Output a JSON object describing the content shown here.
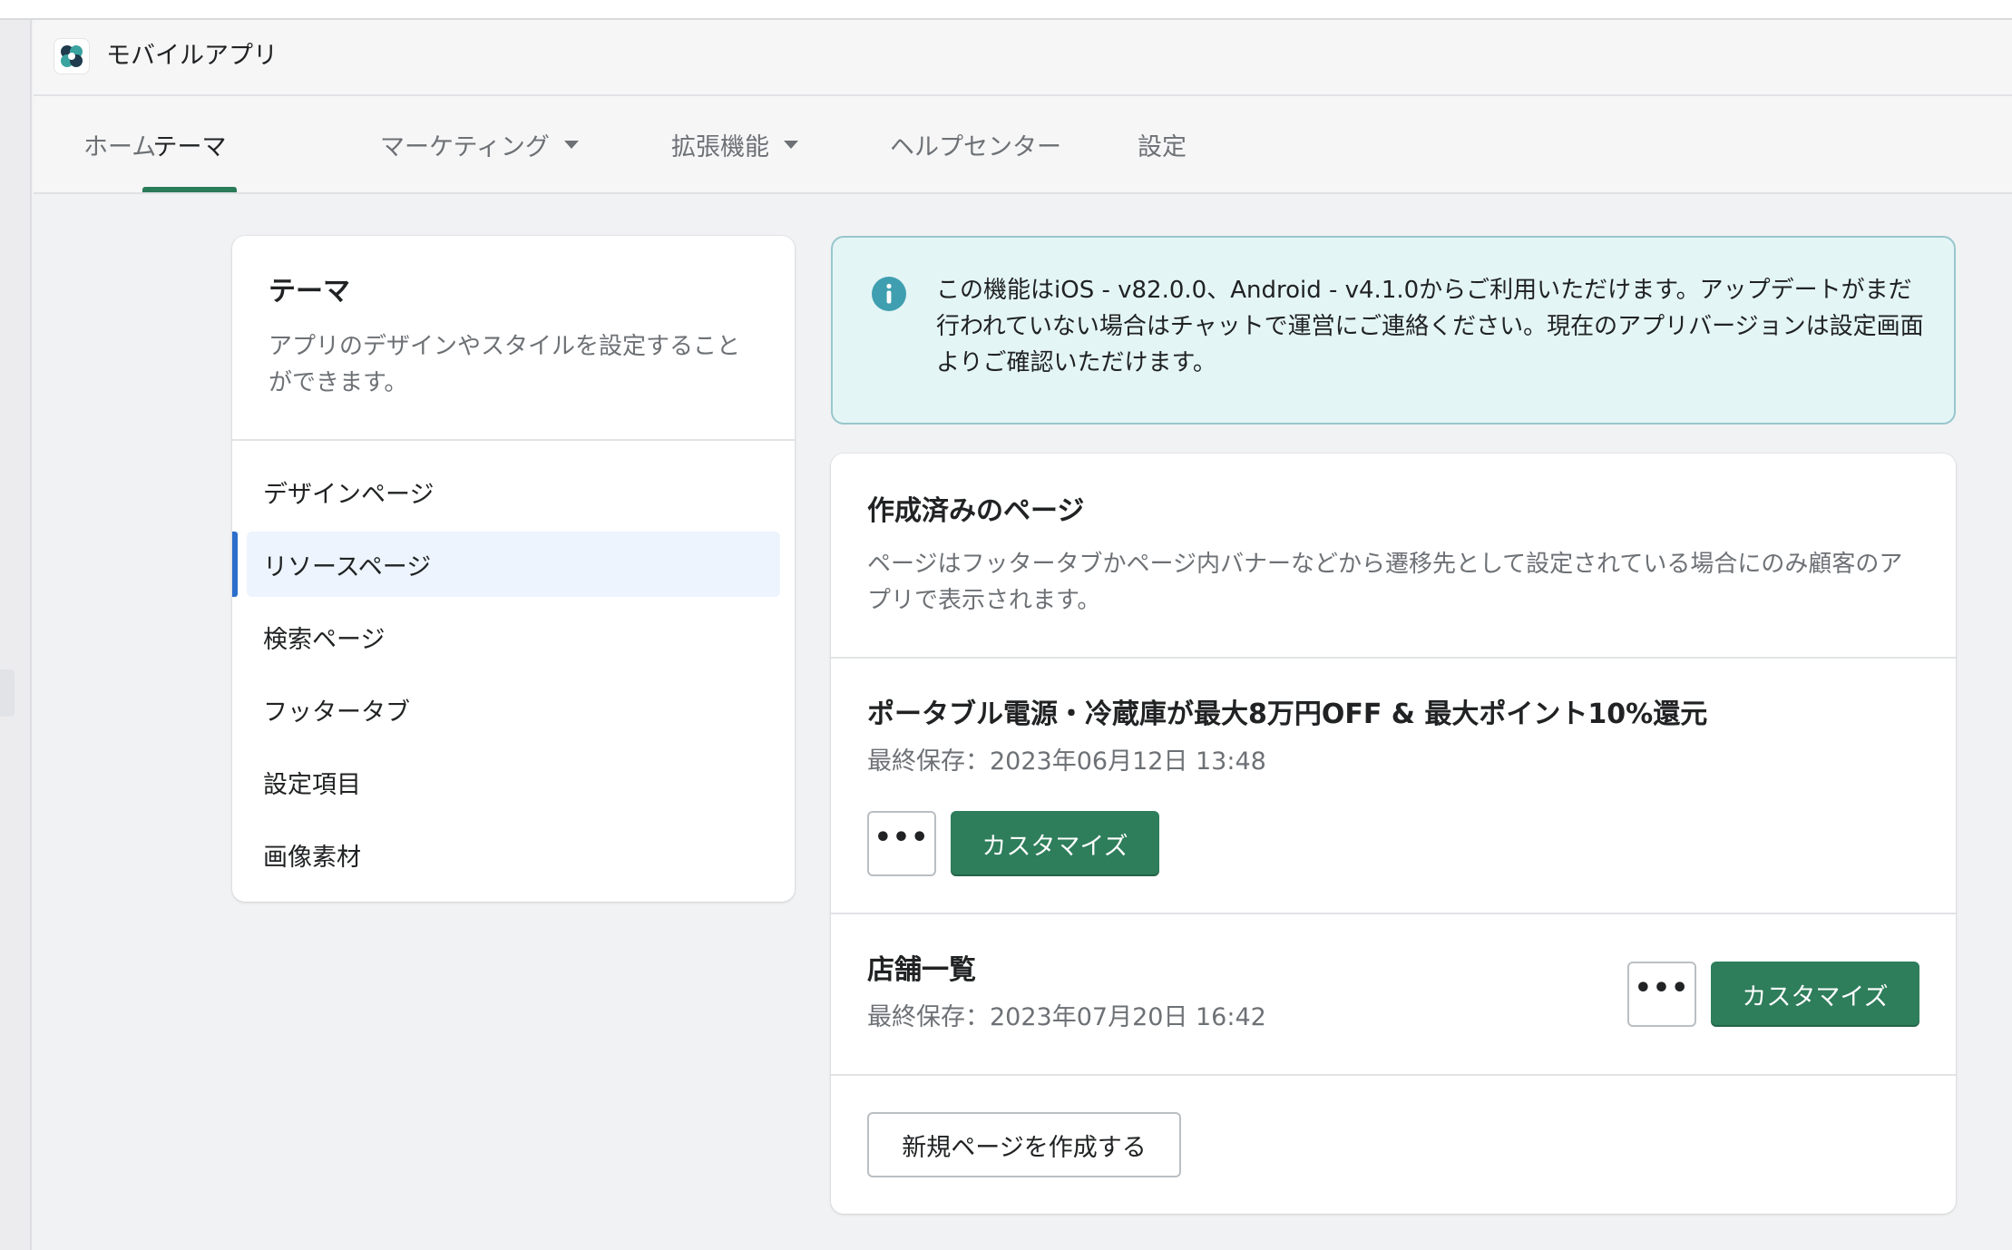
{
  "app": {
    "title": "モバイルアプリ",
    "logo_icon": "app-logo-icon"
  },
  "nav": {
    "tabs": [
      {
        "label": "ホーム",
        "active": false,
        "dropdown": false
      },
      {
        "label": "テーマ",
        "active": true,
        "dropdown": false
      },
      {
        "label": "マーケティング",
        "active": false,
        "dropdown": true
      },
      {
        "label": "拡張機能",
        "active": false,
        "dropdown": true
      },
      {
        "label": "ヘルプセンター",
        "active": false,
        "dropdown": false
      },
      {
        "label": "設定",
        "active": false,
        "dropdown": false
      }
    ]
  },
  "sidebar": {
    "title": "テーマ",
    "description": "アプリのデザインやスタイルを設定することができます。",
    "items": [
      {
        "label": "デザインページ",
        "active": false
      },
      {
        "label": "リソースページ",
        "active": true
      },
      {
        "label": "検索ページ",
        "active": false
      },
      {
        "label": "フッタータブ",
        "active": false
      },
      {
        "label": "設定項目",
        "active": false
      },
      {
        "label": "画像素材",
        "active": false
      }
    ]
  },
  "banner": {
    "icon": "info-icon",
    "text": "この機能はiOS - v82.0.0、Android - v4.1.0からご利用いただけます。アップデートがまだ行われていない場合はチャットで運営にご連絡ください。現在のアプリバージョンは設定画面よりご確認いただけます。"
  },
  "pages": {
    "title": "作成済みのページ",
    "description": "ページはフッタータブかページ内バナーなどから遷移先として設定されている場合にのみ顧客のアプリで表示されます。",
    "items": [
      {
        "title": "ポータブル電源・冷蔵庫が最大8万円OFF & 最大ポイント10%還元",
        "saved": "最終保存：2023年06月12日 13:48",
        "more_label": "•••",
        "customize_label": "カスタマイズ"
      },
      {
        "title": "店舗一覧",
        "saved": "最終保存：2023年07月20日 16:42",
        "more_label": "•••",
        "customize_label": "カスタマイズ"
      }
    ],
    "create_label": "新規ページを作成する"
  },
  "colors": {
    "accent": "#2e7d5b",
    "active_tab_underline": "#2a7b58",
    "sidebar_active_bar": "#2c6ecb",
    "banner_bg": "#e4f5f6",
    "banner_border": "#98c6cd",
    "info_icon": "#3f9fb0"
  }
}
